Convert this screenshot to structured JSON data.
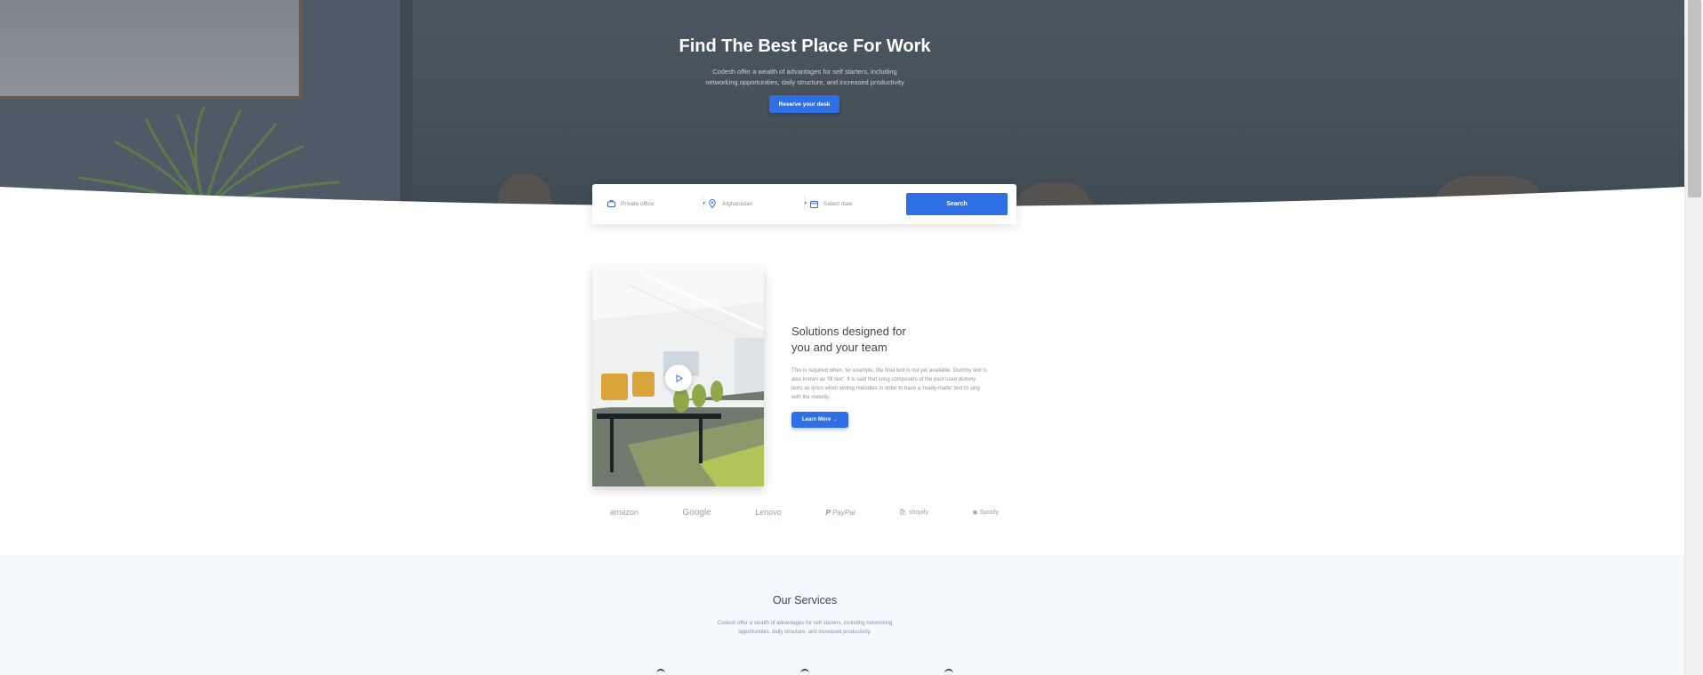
{
  "hero": {
    "title": "Find The Best Place For Work",
    "subtitle_line1": "Codesh offer a wealth of advantages for self starters, including",
    "subtitle_line2": "networking opportunities, daily structure, and increased productivity",
    "cta_label": "Reserve your desk"
  },
  "search": {
    "space_type": {
      "value": "Private office",
      "icon": "briefcase-icon"
    },
    "location": {
      "value": "Afghanistan",
      "icon": "map-pin-icon"
    },
    "date": {
      "placeholder": "Select date",
      "icon": "calendar-icon"
    },
    "button_label": "Search"
  },
  "solutions": {
    "title_line1": "Solutions designed for",
    "title_line2": "you and your team",
    "body_line1": "This is required when, for example, the final text is not yet available. Dummy text is",
    "body_line2": "also known as 'fill text'. It is said that song composers of the past used dummy",
    "body_line3": "texts as lyrics when writing melodies in order to have a 'ready-made' text to sing",
    "body_line4": "with the melody.",
    "button_label": "Learn More →",
    "video_icon": "play-icon"
  },
  "logos": [
    "amazon",
    "Google",
    "Lenovo",
    "PayPal",
    "shopify",
    "Spotify"
  ],
  "services": {
    "title": "Our Services",
    "subtitle_line1": "Codesh offer a wealth of advantages for self starters, including networking",
    "subtitle_line2": "opportunities, daily structure, and increased productivity."
  },
  "colors": {
    "accent": "#2f6fe5",
    "hero_bg": "#46515a",
    "services_bg": "#f5f8fc",
    "heading": "#3f4850",
    "muted_text": "#8c949b"
  }
}
